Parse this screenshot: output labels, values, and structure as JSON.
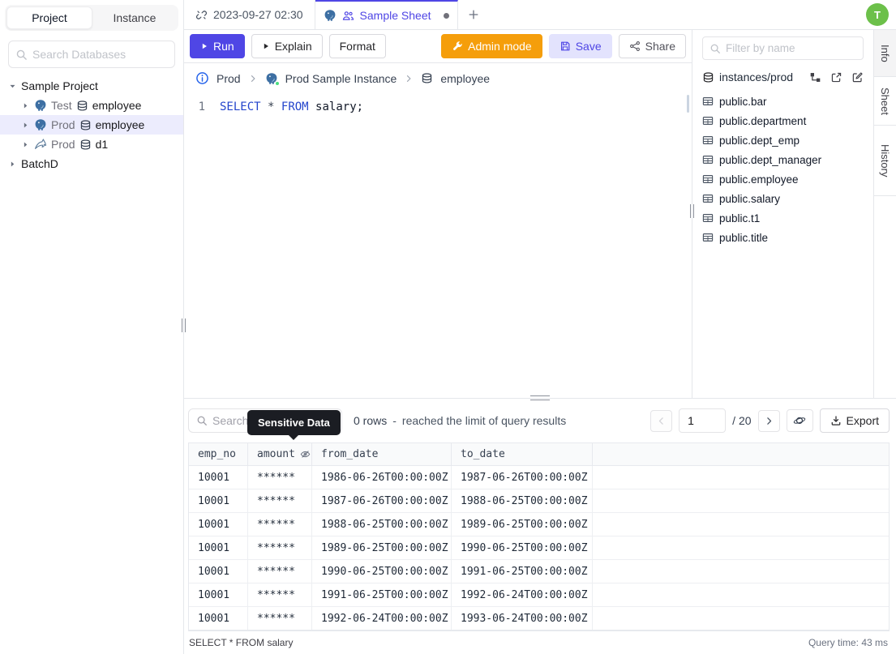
{
  "colors": {
    "accent": "#4f46e5",
    "save_bg": "#e3e3fd",
    "admin_orange": "#f59e0b",
    "avatar_green": "#6cc04a",
    "keyword_blue": "#2445cc",
    "selected_row_bg": "#ececfd",
    "tooltip_bg": "#1b1d23",
    "status_green": "#4ade80"
  },
  "sidebar": {
    "tabs": {
      "project": "Project",
      "instance": "Instance"
    },
    "search_placeholder": "Search Databases",
    "tree": {
      "root": "Sample Project",
      "items": [
        {
          "env": "Test",
          "db": "employee"
        },
        {
          "env": "Prod",
          "db": "employee"
        },
        {
          "env": "Prod",
          "db": "d1"
        }
      ],
      "batch": "BatchD"
    }
  },
  "tabbar": {
    "history_tab": "2023-09-27 02:30",
    "active_tab": "Sample Sheet"
  },
  "avatar_initial": "T",
  "toolbar": {
    "run": "Run",
    "explain": "Explain",
    "format": "Format",
    "admin_mode": "Admin mode",
    "save": "Save",
    "share": "Share"
  },
  "breadcrumb": {
    "env": "Prod",
    "instance": "Prod Sample Instance",
    "database": "employee"
  },
  "editor": {
    "line_no": "1",
    "kw_select": "SELECT",
    "star": "*",
    "kw_from": "FROM",
    "identifier": "salary;"
  },
  "right_panel": {
    "filter_placeholder": "Filter by name",
    "connection": "instances/prod",
    "tables": [
      "public.bar",
      "public.department",
      "public.dept_emp",
      "public.dept_manager",
      "public.employee",
      "public.salary",
      "public.t1",
      "public.title"
    ]
  },
  "side_tabs": {
    "info": "Info",
    "sheet": "Sheet",
    "history": "History"
  },
  "results": {
    "search_placeholder": "Search",
    "tooltip": "Sensitive Data",
    "rows_count": "0 rows",
    "rows_sep": "-",
    "rows_text": "reached the limit of query results",
    "page_value": "1",
    "page_total": "/ 20",
    "export_label": "Export",
    "table": {
      "columns": [
        "emp_no",
        "amount",
        "from_date",
        "to_date"
      ],
      "rows": [
        [
          "10001",
          "******",
          "1986-06-26T00:00:00Z",
          "1987-06-26T00:00:00Z"
        ],
        [
          "10001",
          "******",
          "1987-06-26T00:00:00Z",
          "1988-06-25T00:00:00Z"
        ],
        [
          "10001",
          "******",
          "1988-06-25T00:00:00Z",
          "1989-06-25T00:00:00Z"
        ],
        [
          "10001",
          "******",
          "1989-06-25T00:00:00Z",
          "1990-06-25T00:00:00Z"
        ],
        [
          "10001",
          "******",
          "1990-06-25T00:00:00Z",
          "1991-06-25T00:00:00Z"
        ],
        [
          "10001",
          "******",
          "1991-06-25T00:00:00Z",
          "1992-06-24T00:00:00Z"
        ],
        [
          "10001",
          "******",
          "1992-06-24T00:00:00Z",
          "1993-06-24T00:00:00Z"
        ]
      ]
    },
    "status_left": "SELECT * FROM salary",
    "status_right": "Query time: 43 ms"
  }
}
